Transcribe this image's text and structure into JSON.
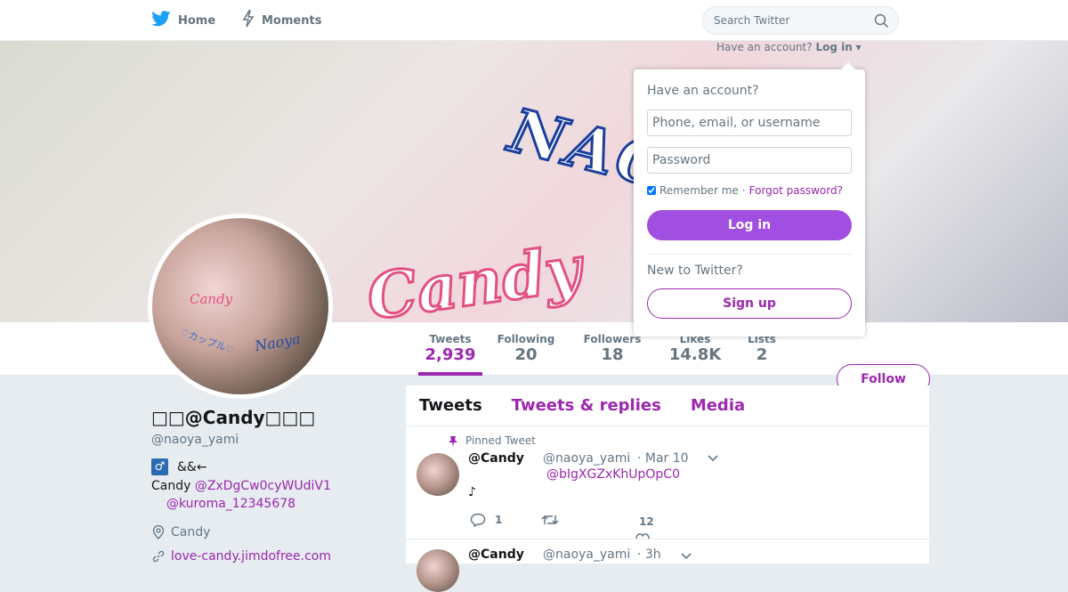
{
  "nav": {
    "home_label": "Home",
    "moments_label": "Moments",
    "search_placeholder": "Search Twitter",
    "have_account_text": "Have an account?",
    "login_link": "Log in"
  },
  "banner": {
    "overlay_text_1": "NAOYA",
    "overlay_text_2": "Candy"
  },
  "avatar": {
    "text_1": "Candy",
    "text_2": "Naoya",
    "text_3": "♡カップル♡"
  },
  "stats": [
    {
      "label": "Tweets",
      "value": "2,939"
    },
    {
      "label": "Following",
      "value": "20"
    },
    {
      "label": "Followers",
      "value": "18"
    },
    {
      "label": "Likes",
      "value": "14.8K"
    },
    {
      "label": "Lists",
      "value": "2"
    }
  ],
  "follow_label": "Follow",
  "profile": {
    "name": "□□@Candy□□□",
    "handle": "@naoya_yami",
    "gender_glyph": "♂",
    "bio_line1": "&&←",
    "bio_line2_prefix": "Candy ",
    "bio_mention_1": "@ZxDgCw0cyWUdiV1",
    "bio_mention_2": "@kuroma_12345678",
    "location": "Candy",
    "url": "love-candy.jimdofree.com"
  },
  "timeline": {
    "tabs": [
      "Tweets",
      "Tweets & replies",
      "Media"
    ],
    "pinned_label": "Pinned Tweet",
    "tweets": [
      {
        "name": "@Candy",
        "handle": "@naoya_yami",
        "date": "· Mar 10",
        "mention": "@bIgXGZxKhUpOpC0",
        "body": "♪",
        "replies": "1",
        "retweets": "",
        "likes": "12"
      },
      {
        "name": "@Candy",
        "handle": "@naoya_yami",
        "date": "· 3h"
      }
    ]
  },
  "login": {
    "title": "Have an account?",
    "username_placeholder": "Phone, email, or username",
    "password_placeholder": "Password",
    "remember_label": "Remember me",
    "separator": "·",
    "forgot_label": "Forgot password?",
    "login_button": "Log in",
    "new_label": "New to Twitter?",
    "signup_button": "Sign up"
  },
  "colors": {
    "accent": "#9c27b0",
    "login_button": "#a14fe0",
    "twitter_blue": "#1da1f2"
  }
}
